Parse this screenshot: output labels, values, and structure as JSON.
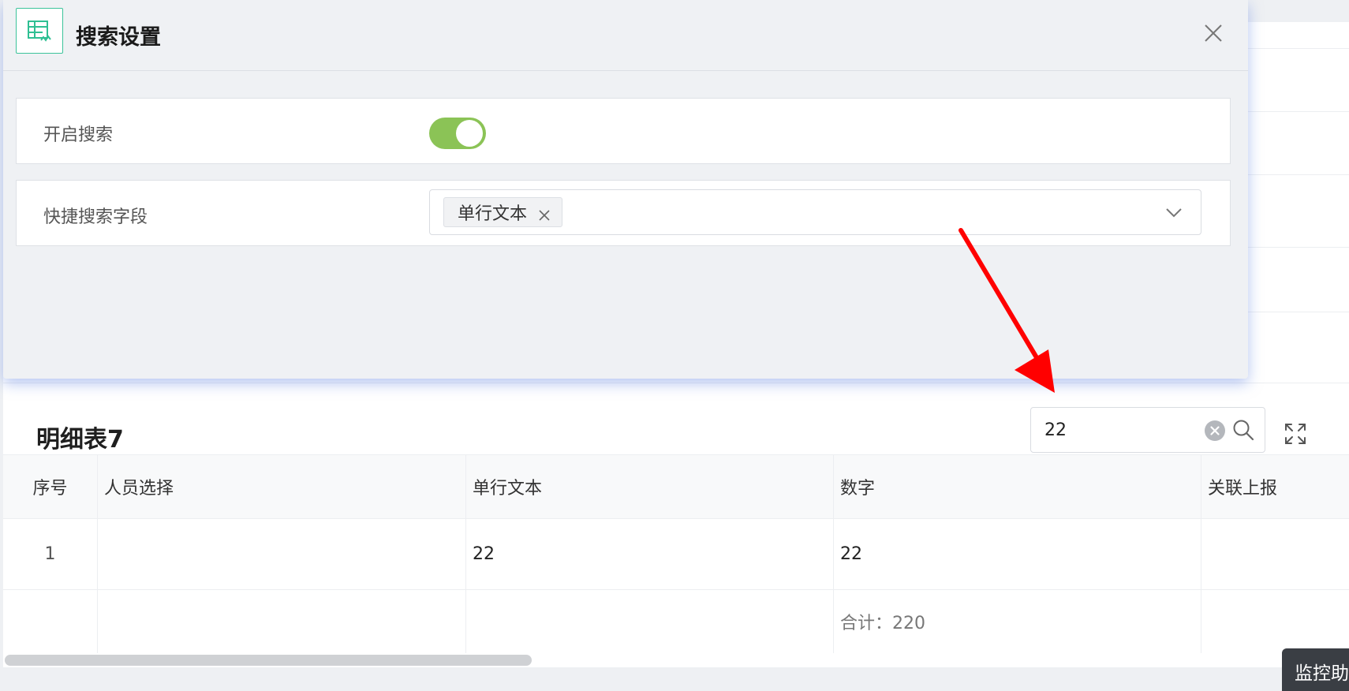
{
  "modal": {
    "title": "搜索设置",
    "enable_search_label": "开启搜索",
    "enable_search_on": true,
    "quick_field_label": "快捷搜索字段",
    "selected_fields": [
      "单行文本"
    ]
  },
  "detail": {
    "title": "明细表7",
    "search_value": "22",
    "columns": [
      "序号",
      "人员选择",
      "单行文本",
      "数字",
      "关联上报"
    ],
    "rows": [
      [
        "1",
        "",
        "22",
        "22",
        ""
      ]
    ],
    "sum_label": "合计：220"
  },
  "badge": {
    "label": "监控助"
  },
  "colors": {
    "toggle_on": "#8bc356",
    "logo_border": "#3cc39a",
    "arrow": "#ff0000"
  }
}
